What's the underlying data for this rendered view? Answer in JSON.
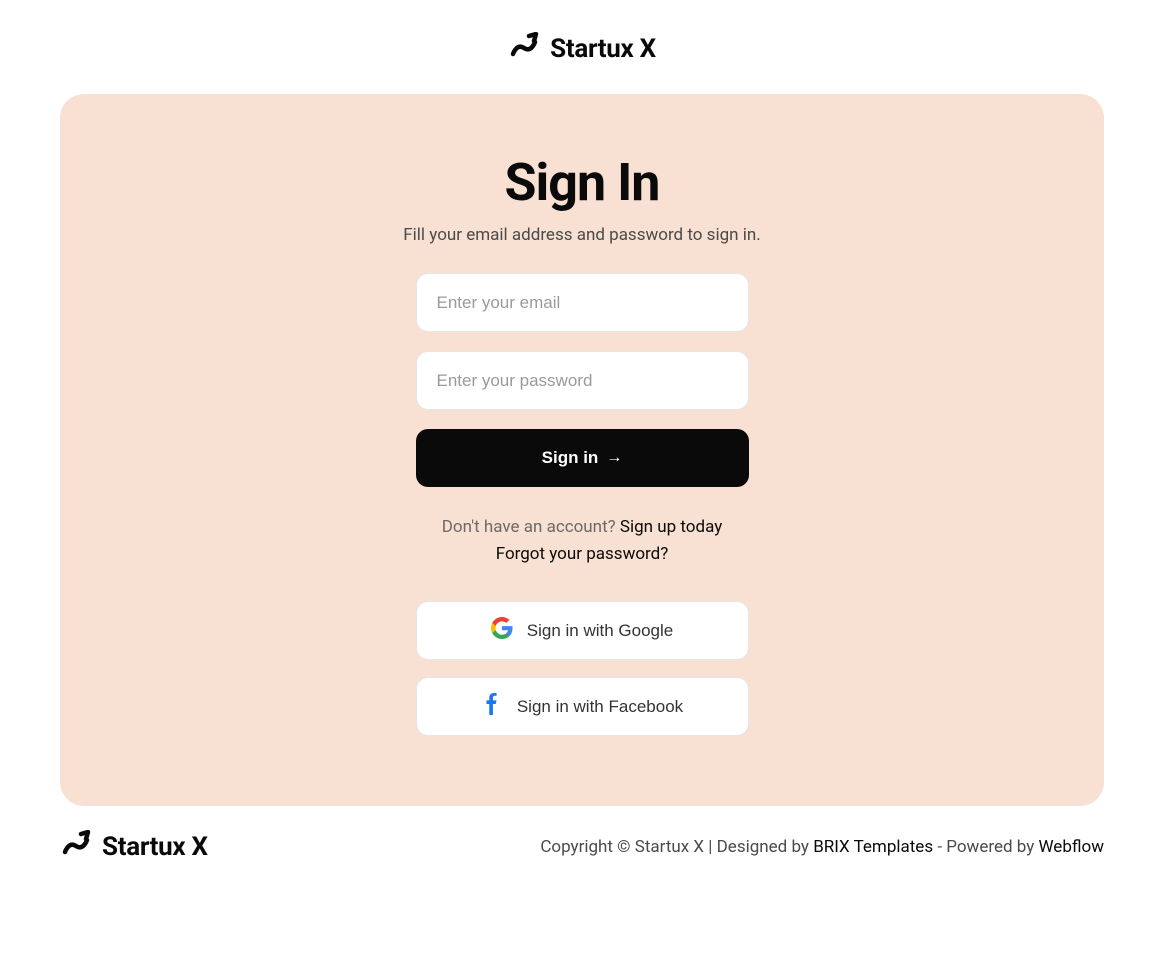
{
  "brand": {
    "name": "Startux X"
  },
  "signin": {
    "title": "Sign In",
    "subtitle": "Fill your email address and password to sign in.",
    "email_placeholder": "Enter your email",
    "password_placeholder": "Enter your password",
    "submit_label": "Sign in",
    "no_account_text": "Don't have an account? ",
    "signup_link": "Sign up today",
    "forgot_link": "Forgot your password?",
    "google_label": "Sign in with Google",
    "facebook_label": "Sign in with Facebook"
  },
  "footer": {
    "copyright": "Copyright © Startux X | Designed by ",
    "designer": "BRIX Templates",
    "powered_by": " - Powered by ",
    "platform": "Webflow"
  }
}
